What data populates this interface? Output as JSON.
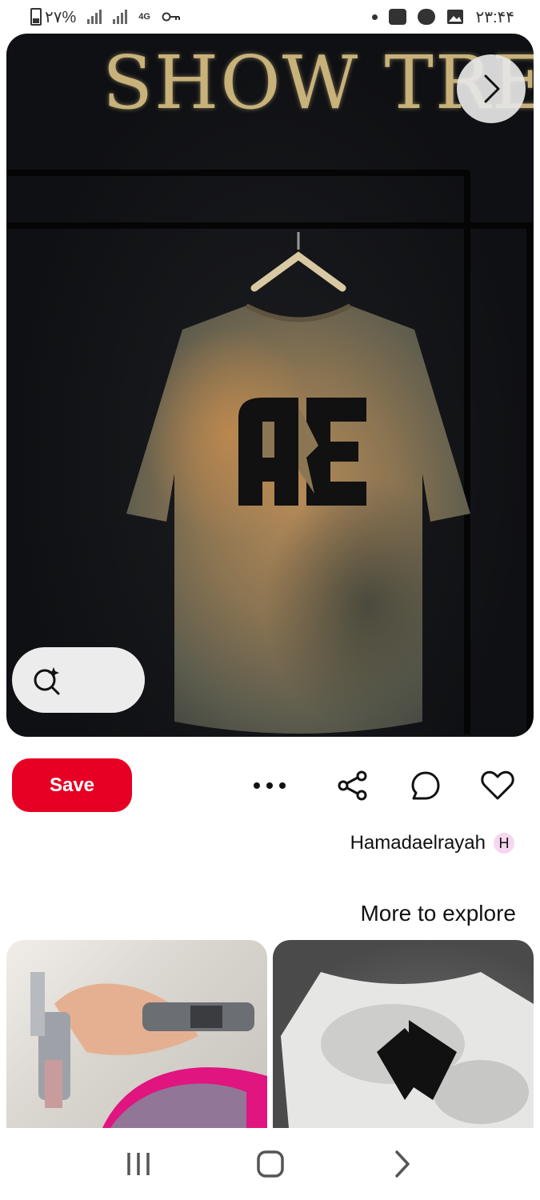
{
  "status": {
    "battery": "٢٧%",
    "network": "4G",
    "time": "٢٣:۴۴"
  },
  "pin": {
    "image_text": "SHOW TREND",
    "shirt_logo": "AE"
  },
  "actions": {
    "save_label": "Save"
  },
  "creator": {
    "name": "Hamadaelrayah",
    "initial": "H"
  },
  "explore": {
    "title": "More to explore"
  },
  "colors": {
    "accent": "#e60023",
    "badge": "#f6d7f0"
  },
  "icons": [
    "battery-icon",
    "signal-icon",
    "vpn-key-icon",
    "messenger-icon",
    "gallery-icon",
    "next-arrow-icon",
    "visual-search-icon",
    "more-icon",
    "share-icon",
    "comment-icon",
    "heart-icon",
    "recents-icon",
    "home-icon",
    "back-icon"
  ]
}
